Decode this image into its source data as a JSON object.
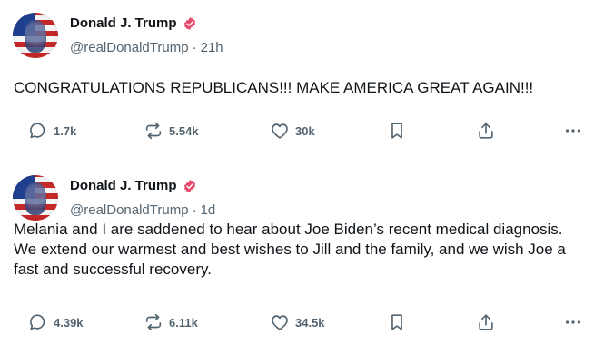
{
  "posts": [
    {
      "author": "Donald J. Trump",
      "handle": "@realDonaldTrump",
      "separator": "·",
      "time": "21h",
      "text": "CONGRATULATIONS REPUBLICANS!!! MAKE AMERICA GREAT AGAIN!!!",
      "replies": "1.7k",
      "reposts": "5.54k",
      "likes": "30k"
    },
    {
      "author": "Donald J. Trump",
      "handle": "@realDonaldTrump",
      "separator": "·",
      "time": "1d",
      "text": "Melania and I are saddened to hear about Joe Biden’s recent medical diagnosis. We extend our warmest and best wishes to Jill and the family, and we wish Joe a fast and successful recovery.",
      "replies": "4.39k",
      "reposts": "6.11k",
      "likes": "34.5k"
    }
  ],
  "colors": {
    "verified_badge": "#e8456b",
    "icon_gray": "#536471",
    "text": "#0f1419"
  },
  "icons": [
    "reply-icon",
    "repost-icon",
    "like-icon",
    "bookmark-icon",
    "share-icon",
    "more-icon",
    "verified-badge-icon"
  ]
}
